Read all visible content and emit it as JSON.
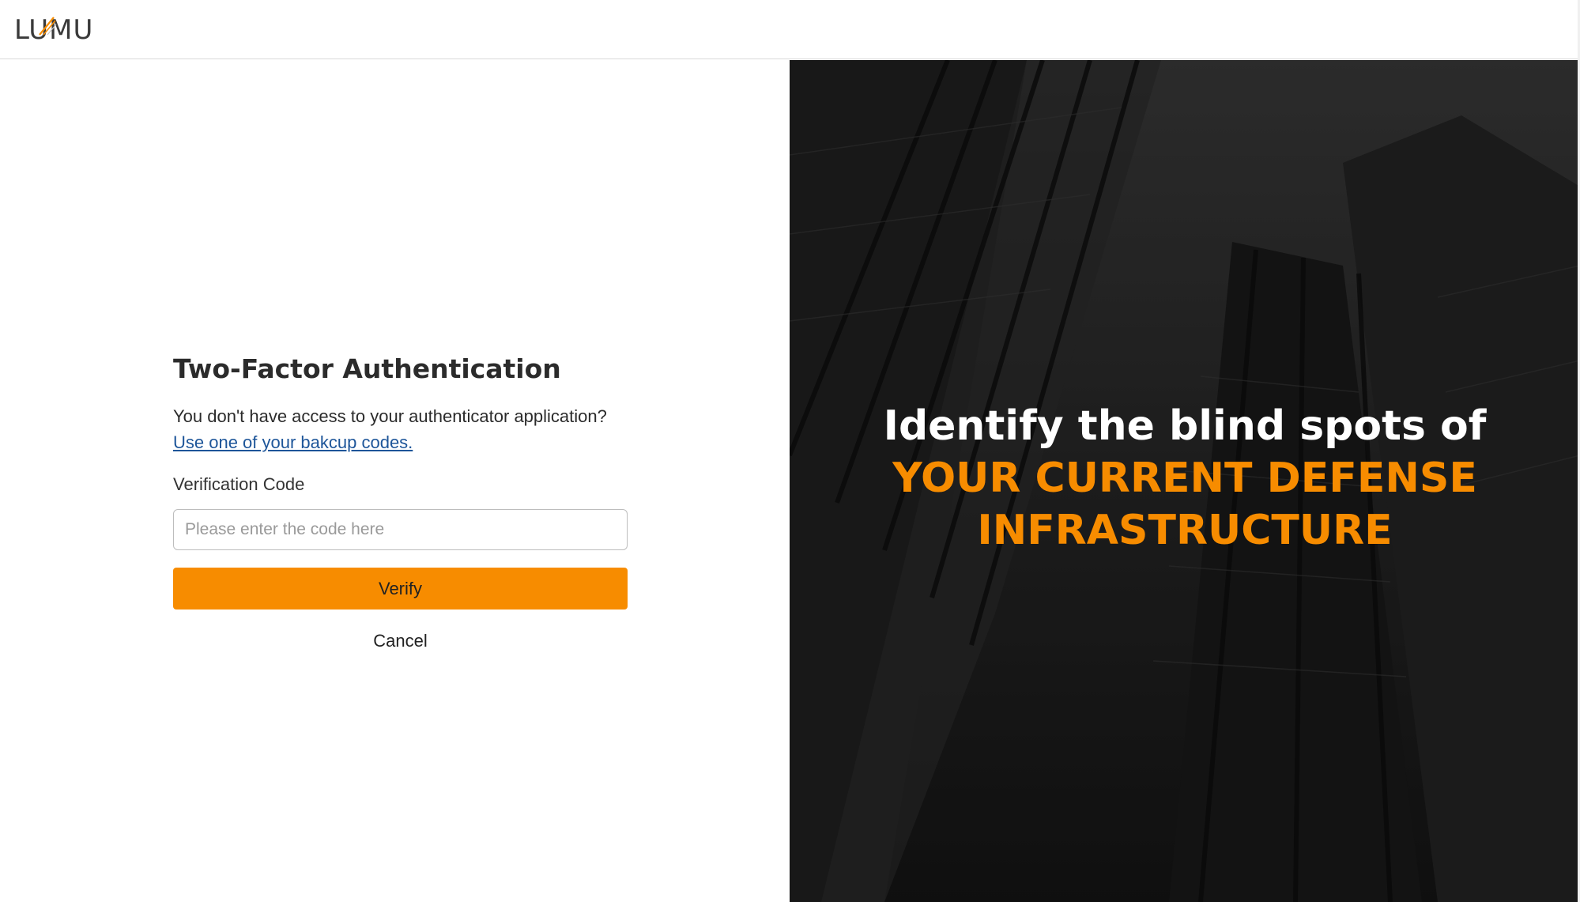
{
  "header": {
    "logo_text": "LUMU"
  },
  "form": {
    "title": "Two-Factor Authentication",
    "helper_text": "You don't have access to your authenticator application?",
    "backup_link": "Use one of your bakcup codes.",
    "field_label": "Verification Code",
    "code_input": {
      "value": "",
      "placeholder": "Please enter the code here"
    },
    "verify_label": "Verify",
    "cancel_label": "Cancel"
  },
  "hero": {
    "line1": "Identify the blind spots of",
    "line2": "YOUR CURRENT DEFENSE",
    "line3": "INFRASTRUCTURE"
  },
  "colors": {
    "accent": "#f78c00",
    "link": "#1d5599",
    "hero_background": "#1d1d1d",
    "text": "#2b2b2b"
  },
  "icons": {
    "logo_mark": "lumu-logo-icon"
  }
}
